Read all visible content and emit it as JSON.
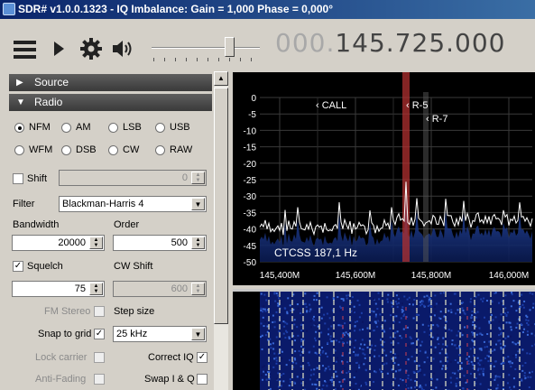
{
  "window": {
    "title": "SDR# v1.0.0.1323 - IQ Imbalance: Gain = 1,000 Phase = 0,000°"
  },
  "toolbar": {
    "menu_icon": "hamburger-menu-icon",
    "play_icon": "play-icon",
    "settings_icon": "gear-icon",
    "volume_icon": "speaker-icon",
    "frequency_prefix": "000.",
    "frequency_main": "145.725.000"
  },
  "source_section": {
    "label": "Source"
  },
  "radio_section": {
    "label": "Radio",
    "modes": [
      "NFM",
      "AM",
      "LSB",
      "USB",
      "WFM",
      "DSB",
      "CW",
      "RAW"
    ],
    "selected_mode": "NFM",
    "shift_label": "Shift",
    "shift_value": "0",
    "filter_label": "Filter",
    "filter_value": "Blackman-Harris 4",
    "bandwidth_label": "Bandwidth",
    "bandwidth_value": "20000",
    "order_label": "Order",
    "order_value": "500",
    "squelch_label": "Squelch",
    "squelch_value": "75",
    "cw_shift_label": "CW Shift",
    "cw_shift_value": "600",
    "fm_stereo_label": "FM Stereo",
    "step_size_label": "Step size",
    "snap_to_grid_label": "Snap to grid",
    "step_size_value": "25 kHz",
    "lock_carrier_label": "Lock carrier",
    "correct_iq_label": "Correct IQ",
    "anti_fading_label": "Anti-Fading",
    "swap_iq_label": "Swap I & Q"
  },
  "spectrum": {
    "y_ticks": [
      "0",
      "-5",
      "-10",
      "-15",
      "-20",
      "-25",
      "-30",
      "-35",
      "-40",
      "-45",
      "-50"
    ],
    "x_ticks": [
      "145,400M",
      "145,600M",
      "145,800M",
      "146,000M"
    ],
    "markers": [
      "CALL",
      "R-5",
      "R-7"
    ],
    "ctcss_text": "CTCSS  187,1 Hz",
    "trace_color": "#ffffff",
    "background_color": "#000000",
    "filter_band_color": "#b03030"
  }
}
